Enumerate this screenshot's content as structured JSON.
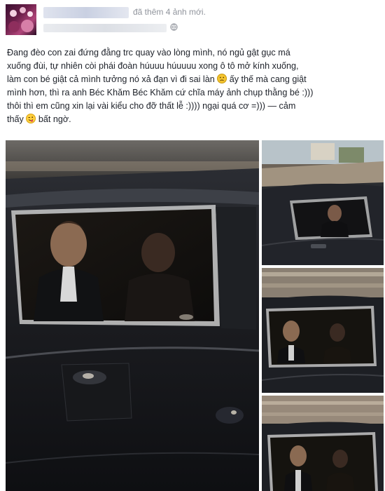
{
  "post": {
    "action": "đã thêm 4 ảnh mới.",
    "text_line_1": "Đang đèo con zai đứng đằng trc quay vào lòng mình, nó ngủ gật gục má",
    "text_line_2": "xuống đùi, tự nhiên còi phái đoàn húuuu húuuuu xong ô tô mở kính xuống,",
    "text_line_3a": "làm con bé giật cả mình tưởng nó xả đạn vì đi sai làn",
    "text_line_3b": "ấy thế mà cang giật",
    "text_line_4": "mình hơn, thì ra anh Béc Khăm Béc Khăm cứ chĩa máy ảnh chụp thằng bé :)))",
    "text_line_5": "thôi thì em cũng xin lại vài kiểu cho đỡ thất lễ :)))) ngại quá cơ =))) — cảm",
    "text_line_6a": "thấy",
    "text_line_6b": "bất ngờ."
  },
  "icons": {
    "sad": "sad-face-emoji",
    "tongue": "tongue-out-emoji",
    "privacy": "globe-icon"
  },
  "colors": {
    "text": "#1d2129",
    "meta": "#90949c"
  }
}
